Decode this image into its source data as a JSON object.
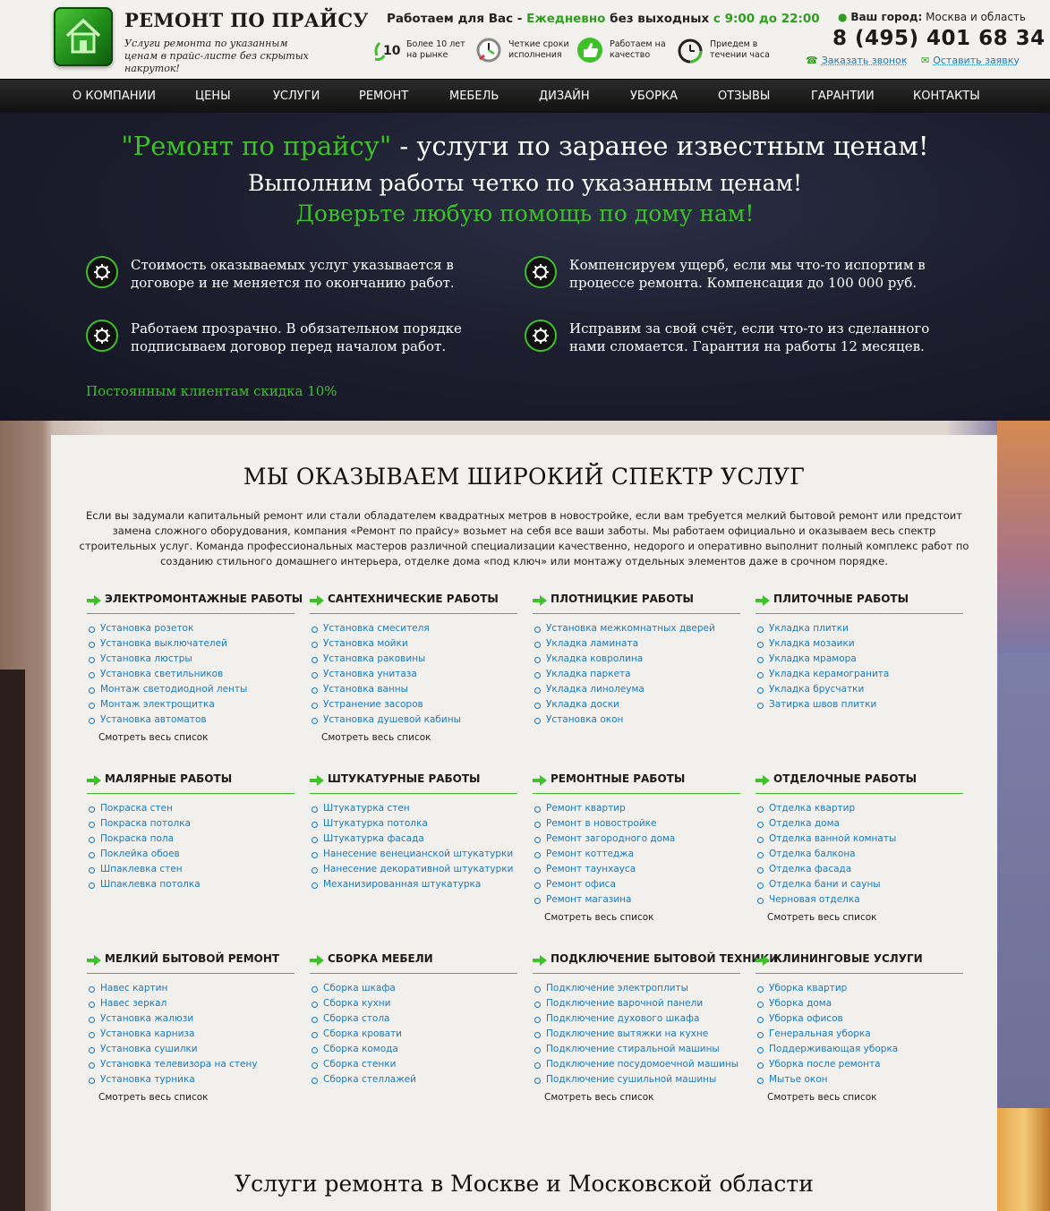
{
  "header": {
    "brand_title": "РЕМОНТ ПО ПРАЙСУ",
    "brand_subtitle": "Услуги ремонта по указанным ценам в прайс-листе без скрытых накруток!",
    "hours_prefix": "Работаем для Вас -",
    "hours_daily": "Ежедневно",
    "hours_mid": "без выходных",
    "hours_from": "с 9:00 до 22:00",
    "features": [
      {
        "icon": "badge-10-years-icon",
        "text1": "Более 10 лет",
        "text2": "на рынке"
      },
      {
        "icon": "clock-deadline-icon",
        "text1": "Четкие сроки",
        "text2": "исполнения"
      },
      {
        "icon": "thumbs-up-icon",
        "text1": "Работаем на",
        "text2": "качество"
      },
      {
        "icon": "stopwatch-icon",
        "text1": "Приедем в",
        "text2": "течении часа"
      }
    ],
    "city_label": "Ваш город:",
    "city_value": "Москва и область",
    "phone": "8 (495) 401 68 34",
    "callback_link": "Заказать звонок",
    "request_link": "Оставить заявку"
  },
  "nav": [
    "О КОМПАНИИ",
    "ЦЕНЫ",
    "УСЛУГИ",
    "РЕМОНТ",
    "МЕБЕЛЬ",
    "ДИЗАЙН",
    "УБОРКА",
    "ОТЗЫВЫ",
    "ГАРАНТИИ",
    "КОНТАКТЫ"
  ],
  "hero": {
    "title_green": "\"Ремонт по прайсу\"",
    "title_rest": " - услуги по заранее известным ценам!",
    "line2": "Выполним работы четко по указанным ценам!",
    "line3": "Доверьте любую помощь по дому нам!",
    "advantages": [
      "Стоимость оказываемых услуг указывается в договоре и не меняется по окончанию работ.",
      "Компенсируем ущерб, если мы что-то испортим в процессе ремонта. Компенсация до 100 000 руб.",
      "Работаем прозрачно. В обязательном порядке подписываем договор перед началом работ.",
      "Исправим за свой счёт, если что-то из сделанного нами сломается. Гарантия на работы 12 месяцев."
    ],
    "discount": "Постоянным клиентам скидка 10%"
  },
  "services": {
    "title": "МЫ ОКАЗЫВАЕМ ШИРОКИЙ СПЕКТР УСЛУГ",
    "intro": "Если вы задумали капитальный ремонт или стали обладателем квадратных метров в новостройке, если вам требуется мелкий бытовой ремонт или предстоит замена сложного оборудования, компания «Ремонт по прайсу» возьмет на себя все ваши заботы. Мы работаем официально и оказываем весь спектр строительных услуг. Команда профессиональных мастеров различной специализации качественно, недорого и оперативно выполнит полный комплекс работ по созданию стильного домашнего интерьера, отделке дома «под ключ» или монтажу отдельных элементов даже в срочном порядке.",
    "more_label": "Смотреть весь список",
    "groups": [
      {
        "title": "ЭЛЕКТРОМОНТАЖНЫЕ РАБОТЫ",
        "items": [
          "Установка розеток",
          "Установка выключателей",
          "Установка люстры",
          "Установка светильников",
          "Монтаж светодиодной ленты",
          "Монтаж электрощитка",
          "Установка автоматов"
        ],
        "more": true
      },
      {
        "title": "САНТЕХНИЧЕСКИЕ РАБОТЫ",
        "items": [
          "Установка смесителя",
          "Установка мойки",
          "Установка раковины",
          "Установка унитаза",
          "Установка ванны",
          "Устранение засоров",
          "Установка душевой кабины"
        ],
        "more": true
      },
      {
        "title": "ПЛОТНИЦКИЕ РАБОТЫ",
        "items": [
          "Установка межкомнатных дверей",
          "Укладка ламината",
          "Укладка ковролина",
          "Укладка паркета",
          "Укладка линолеума",
          "Укладка доски",
          "Установка окон"
        ],
        "more": false
      },
      {
        "title": "ПЛИТОЧНЫЕ РАБОТЫ",
        "items": [
          "Укладка плитки",
          "Укладка мозаики",
          "Укладка мрамора",
          "Укладка керамогранита",
          "Укладка брусчатки",
          "Затирка швов плитки"
        ],
        "more": false
      },
      {
        "title": "МАЛЯРНЫЕ РАБОТЫ",
        "items": [
          "Покраска стен",
          "Покраска потолка",
          "Покраска пола",
          "Поклейка обоев",
          "Шпаклевка стен",
          "Шпаклевка потолка"
        ],
        "more": false
      },
      {
        "title": "ШТУКАТУРНЫЕ РАБОТЫ",
        "items": [
          "Штукатурка стен",
          "Штукатурка потолка",
          "Штукатурка фасада",
          "Нанесение венецианской штукатурки",
          "Нанесение декоративной штукатурки",
          "Механизированная штукатурка"
        ],
        "more": false
      },
      {
        "title": "РЕМОНТНЫЕ РАБОТЫ",
        "items": [
          "Ремонт квартир",
          "Ремонт в новостройке",
          "Ремонт загородного дома",
          "Ремонт коттеджа",
          "Ремонт таунхауса",
          "Ремонт офиса",
          "Ремонт магазина"
        ],
        "more": true
      },
      {
        "title": "ОТДЕЛОЧНЫЕ РАБОТЫ",
        "items": [
          "Отделка квартир",
          "Отделка дома",
          "Отделка ванной комнаты",
          "Отделка балкона",
          "Отделка фасада",
          "Отделка бани и сауны",
          "Черновая отделка"
        ],
        "more": true
      },
      {
        "title": "МЕЛКИЙ БЫТОВОЙ РЕМОНТ",
        "items": [
          "Навес картин",
          "Навес зеркал",
          "Установка жалюзи",
          "Установка карниза",
          "Установка сушилки",
          "Установка телевизора на стену",
          "Установка турника"
        ],
        "more": true
      },
      {
        "title": "СБОРКА МЕБЕЛИ",
        "items": [
          "Сборка шкафа",
          "Сборка кухни",
          "Сборка стола",
          "Сборка кровати",
          "Сборка комода",
          "Сборка стенки",
          "Сборка стеллажей"
        ],
        "more": false
      },
      {
        "title": "ПОДКЛЮЧЕНИЕ БЫТОВОЙ ТЕХНИКИ",
        "items": [
          "Подключение электроплиты",
          "Подключение варочной панели",
          "Подключение духового шкафа",
          "Подключение вытяжки на кухне",
          "Подключение стиральной машины",
          "Подключение посудомоечной машины",
          "Подключение сушильной машины"
        ],
        "more": true
      },
      {
        "title": "КЛИНИНГОВЫЕ УСЛУГИ",
        "items": [
          "Уборка квартир",
          "Уборка дома",
          "Уборка офисов",
          "Генеральная уборка",
          "Поддерживающая уборка",
          "Уборка после ремонта",
          "Мытье окон"
        ],
        "more": true
      }
    ]
  },
  "bottom_title": "Услуги ремонта в Москве и Московской области",
  "colors": {
    "accent_green": "#3fbf2a",
    "link_blue": "#1a7ac7",
    "nav_bg": "#1a1a1a",
    "hero_bg": "#1d1f30"
  }
}
